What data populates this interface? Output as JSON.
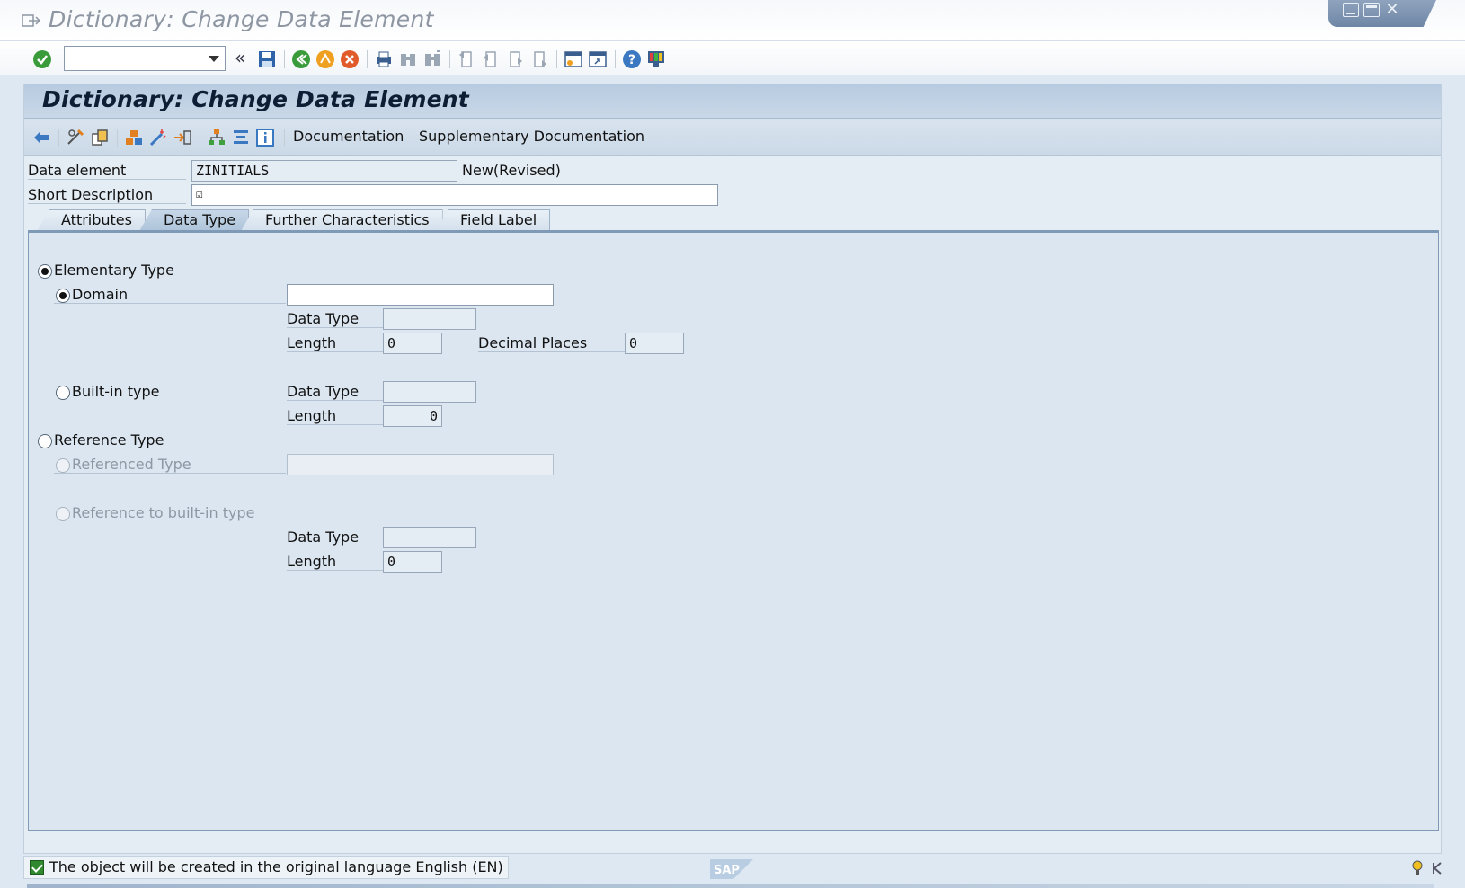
{
  "window": {
    "title": "Dictionary: Change Data Element"
  },
  "screen": {
    "title": "Dictionary: Change Data Element"
  },
  "app_toolbar": {
    "documentation": "Documentation",
    "supplementary_documentation": "Supplementary Documentation"
  },
  "header": {
    "data_element_label": "Data element",
    "data_element_value": "ZINITIALS",
    "status": "New(Revised)",
    "short_description_label": "Short Description",
    "short_description_value": "☑"
  },
  "tabs": [
    {
      "label": "Attributes",
      "active": false
    },
    {
      "label": "Data Type",
      "active": true
    },
    {
      "label": "Further Characteristics",
      "active": false
    },
    {
      "label": "Field Label",
      "active": false
    }
  ],
  "data_type_tab": {
    "elementary_type": "Elementary Type",
    "domain": "Domain",
    "domain_value": "",
    "domain_data_type_label": "Data Type",
    "domain_data_type_value": "",
    "domain_length_label": "Length",
    "domain_length_value": "0",
    "decimal_places_label": "Decimal Places",
    "decimal_places_value": "0",
    "builtin_type": "Built-in type",
    "builtin_data_type_label": "Data Type",
    "builtin_data_type_value": "",
    "builtin_length_label": "Length",
    "builtin_length_value": "0",
    "reference_type": "Reference Type",
    "referenced_type": "Referenced Type",
    "referenced_type_value": "",
    "reference_builtin": "Reference to built-in type",
    "ref_data_type_label": "Data Type",
    "ref_data_type_value": "",
    "ref_length_label": "Length",
    "ref_length_value": "0"
  },
  "status_bar": {
    "message": "The object will be created in the original language English (EN)"
  },
  "colors": {
    "screen_bg": "#e4ecf4",
    "title_bar": "#b7cbe0",
    "ok_green": "#2f8a2f"
  }
}
